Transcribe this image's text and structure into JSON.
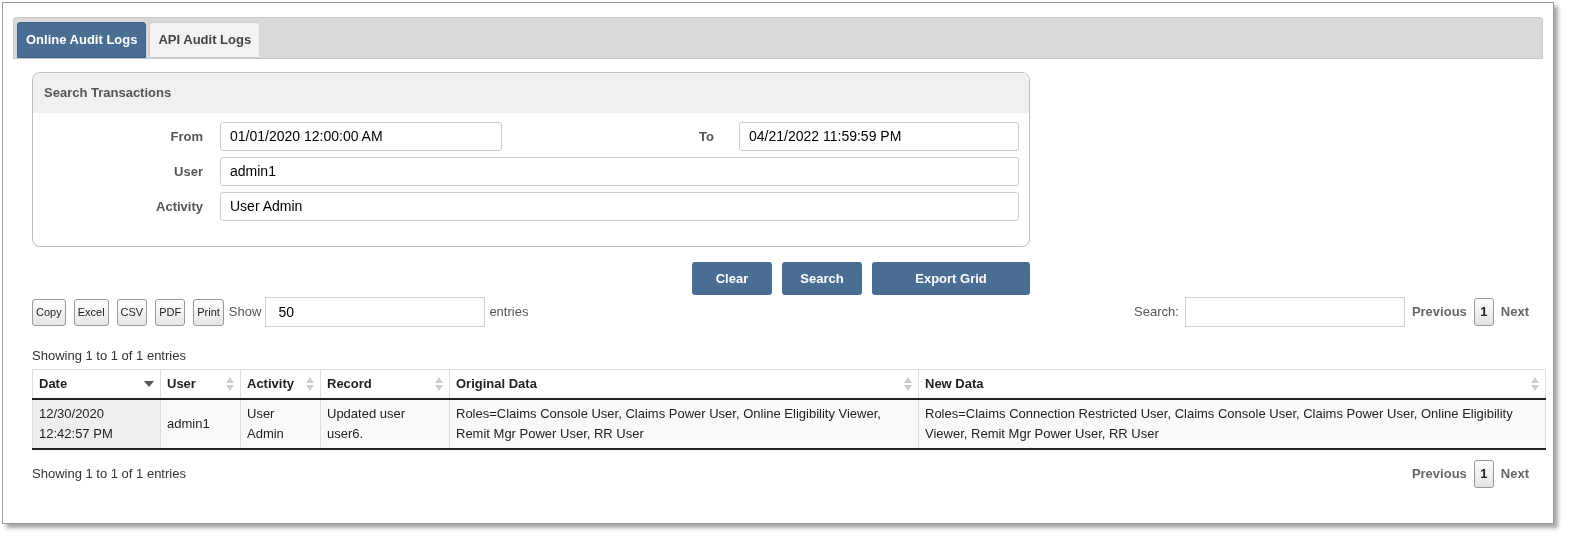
{
  "tabs": [
    {
      "label": "Online Audit Logs",
      "selected": true
    },
    {
      "label": "API Audit Logs",
      "selected": false
    }
  ],
  "search_panel": {
    "title": "Search Transactions",
    "from": {
      "label": "From",
      "value": "01/01/2020 12:00:00 AM"
    },
    "to": {
      "label": "To",
      "value": "04/21/2022 11:59:59 PM"
    },
    "user": {
      "label": "User",
      "value": "admin1"
    },
    "activity": {
      "label": "Activity",
      "value": "User Admin"
    }
  },
  "actions": [
    "Clear",
    "Search",
    "Export Grid"
  ],
  "export_buttons": [
    "Copy",
    "Excel",
    "CSV",
    "PDF",
    "Print"
  ],
  "length": {
    "label_before": "Show",
    "value": "50",
    "label_after": "entries"
  },
  "filter": {
    "label": "Search:"
  },
  "pagination_top": {
    "previous": "Previous",
    "page": "1",
    "next": "Next"
  },
  "info_top": "Showing 1 to 1 of 1 entries",
  "table": {
    "columns": [
      {
        "label": "Date",
        "sorted": true
      },
      {
        "label": "User",
        "sorted": false
      },
      {
        "label": "Activity",
        "sorted": false
      },
      {
        "label": "Record",
        "sorted": false
      },
      {
        "label": "Original Data",
        "sorted": false
      },
      {
        "label": "New Data",
        "sorted": false
      }
    ],
    "rows": [
      [
        "12/30/2020 12:42:57 PM",
        "admin1",
        "User Admin",
        "Updated user user6.",
        "Roles=Claims Console User, Claims Power User, Online Eligibility Viewer, Remit Mgr Power User, RR User",
        "Roles=Claims Connection Restricted User, Claims Console User, Claims Power User, Online Eligibility Viewer, Remit Mgr Power User, RR User"
      ]
    ]
  },
  "info_bottom": "Showing 1 to 1 of 1 entries",
  "pagination_bottom": {
    "previous": "Previous",
    "page": "1",
    "next": "Next"
  }
}
